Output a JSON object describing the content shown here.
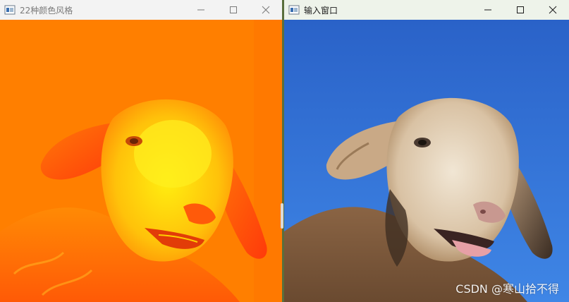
{
  "left_window": {
    "title": "22种颜色风格",
    "image_desc_icon": "color-mapped-sheep-image",
    "colors": {
      "titlebar": "#f3f3f3",
      "bg": "#ff7a00",
      "highlight": "#ffea00"
    }
  },
  "right_window": {
    "title": "输入窗口",
    "image_desc_icon": "original-sheep-image",
    "colors": {
      "titlebar": "#eef3ea",
      "sky": "#2f72d6"
    }
  },
  "controls": {
    "minimize_icon": "minimize-icon",
    "maximize_icon": "maximize-icon",
    "close_icon": "close-icon"
  },
  "watermark": "CSDN @寒山拾不得"
}
